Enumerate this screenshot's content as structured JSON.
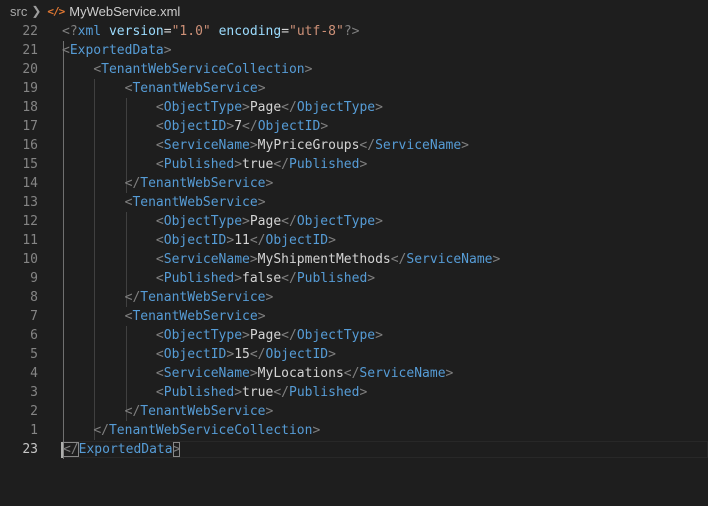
{
  "breadcrumb": {
    "folder": "src",
    "icon": "xml-file-icon",
    "file": "MyWebService.xml"
  },
  "editor": {
    "current_line": "23",
    "line_numbers": [
      "22",
      "21",
      "20",
      "19",
      "18",
      "17",
      "16",
      "15",
      "14",
      "13",
      "12",
      "11",
      "10",
      "9",
      "8",
      "7",
      "6",
      "5",
      "4",
      "3",
      "2",
      "1",
      "23"
    ],
    "lines": [
      {
        "indent": "",
        "kind": "decl",
        "version": "1.0",
        "encoding": "utf-8"
      },
      {
        "indent": "",
        "kind": "open",
        "tag": "ExportedData"
      },
      {
        "indent": "    ",
        "kind": "open",
        "tag": "TenantWebServiceCollection"
      },
      {
        "indent": "        ",
        "kind": "open",
        "tag": "TenantWebService"
      },
      {
        "indent": "            ",
        "kind": "elem",
        "tag": "ObjectType",
        "text": "Page"
      },
      {
        "indent": "            ",
        "kind": "elem",
        "tag": "ObjectID",
        "text": "7"
      },
      {
        "indent": "            ",
        "kind": "elem",
        "tag": "ServiceName",
        "text": "MyPriceGroups"
      },
      {
        "indent": "            ",
        "kind": "elem",
        "tag": "Published",
        "text": "true"
      },
      {
        "indent": "        ",
        "kind": "close",
        "tag": "TenantWebService"
      },
      {
        "indent": "        ",
        "kind": "open",
        "tag": "TenantWebService"
      },
      {
        "indent": "            ",
        "kind": "elem",
        "tag": "ObjectType",
        "text": "Page"
      },
      {
        "indent": "            ",
        "kind": "elem",
        "tag": "ObjectID",
        "text": "11"
      },
      {
        "indent": "            ",
        "kind": "elem",
        "tag": "ServiceName",
        "text": "MyShipmentMethods"
      },
      {
        "indent": "            ",
        "kind": "elem",
        "tag": "Published",
        "text": "false"
      },
      {
        "indent": "        ",
        "kind": "close",
        "tag": "TenantWebService"
      },
      {
        "indent": "        ",
        "kind": "open",
        "tag": "TenantWebService"
      },
      {
        "indent": "            ",
        "kind": "elem",
        "tag": "ObjectType",
        "text": "Page"
      },
      {
        "indent": "            ",
        "kind": "elem",
        "tag": "ObjectID",
        "text": "15"
      },
      {
        "indent": "            ",
        "kind": "elem",
        "tag": "ServiceName",
        "text": "MyLocations"
      },
      {
        "indent": "            ",
        "kind": "elem",
        "tag": "Published",
        "text": "true"
      },
      {
        "indent": "        ",
        "kind": "close",
        "tag": "TenantWebService"
      },
      {
        "indent": "    ",
        "kind": "close",
        "tag": "TenantWebServiceCollection"
      },
      {
        "indent": "",
        "kind": "close",
        "tag": "ExportedData",
        "cursor": true
      }
    ]
  },
  "colors": {
    "background": "#1e1e1e",
    "tag": "#569cd6",
    "bracket": "#808080",
    "attribute": "#9cdcfe",
    "string": "#ce9178",
    "text": "#d4d4d4",
    "line_number": "#858585",
    "xml_icon": "#e37933"
  }
}
